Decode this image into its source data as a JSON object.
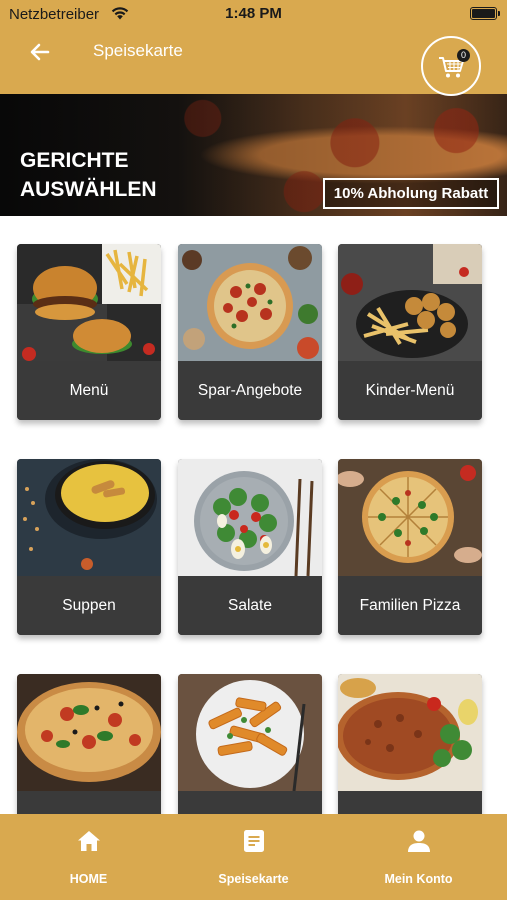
{
  "status_bar": {
    "carrier": "Netzbetreiber",
    "time": "1:48 PM"
  },
  "nav": {
    "title": "Speisekarte",
    "cart_count": "0"
  },
  "banner": {
    "heading_line1": "GERICHTE",
    "heading_line2": "AUSWÄHLEN",
    "promo": "10% Abholung Rabatt"
  },
  "categories": [
    {
      "label": "Menü",
      "image": "burger-fries-photo"
    },
    {
      "label": "Spar-Angebote",
      "image": "pizza-table-photo"
    },
    {
      "label": "Kinder-Menü",
      "image": "nuggets-fries-photo"
    },
    {
      "label": "Suppen",
      "image": "soup-bowl-photo"
    },
    {
      "label": "Salate",
      "image": "salad-plate-photo"
    },
    {
      "label": "Familien Pizza",
      "image": "family-pizza-photo"
    },
    {
      "label": "",
      "image": "pizza-photo"
    },
    {
      "label": "",
      "image": "pasta-photo"
    },
    {
      "label": "",
      "image": "lahmacun-photo"
    }
  ],
  "tabs": [
    {
      "label": "HOME",
      "icon": "home-icon"
    },
    {
      "label": "Speisekarte",
      "icon": "menu-document-icon"
    },
    {
      "label": "Mein Konto",
      "icon": "user-icon"
    }
  ],
  "colors": {
    "accent": "#d9a94f",
    "card": "#3a3a3a",
    "text_light": "#ffffff"
  }
}
